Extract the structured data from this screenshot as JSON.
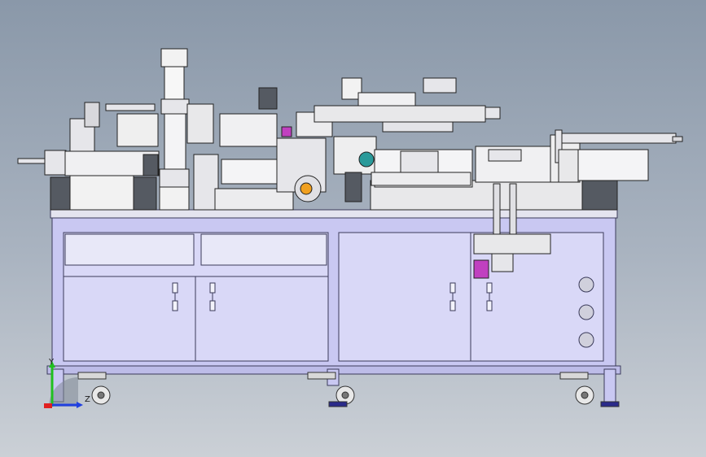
{
  "viewport": {
    "background_top": "#8a98a9",
    "background_bottom": "#cbd0d6"
  },
  "model": {
    "frame_color": "#c9c8f2",
    "frame_edge": "#3a3a5a",
    "panel_color": "#d9d8f7",
    "metal_color": "#e6e6ea",
    "dark_metal": "#555a62",
    "accent_orange": "#f0a020",
    "accent_magenta": "#c040c0",
    "accent_green": "#3aa86a",
    "accent_teal": "#2a9a9a"
  },
  "triad": {
    "x_label": "",
    "y_label": "Y",
    "z_label": "Z",
    "x_color": "#e02020",
    "y_color": "#20c020",
    "z_color": "#2040e0"
  }
}
